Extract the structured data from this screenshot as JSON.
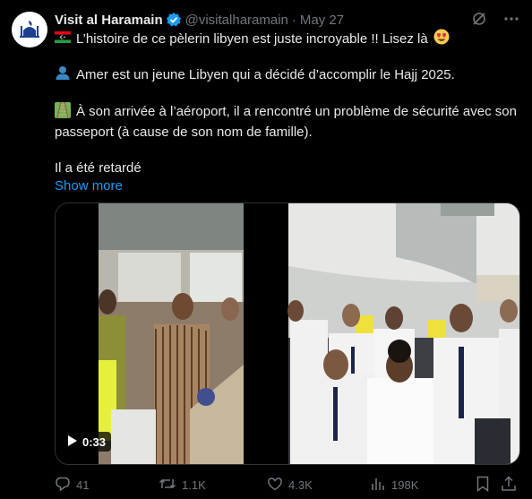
{
  "author": {
    "name": "Visit al Haramain",
    "handle": "@visitalharamain",
    "separator": "·",
    "date": "May 27"
  },
  "post": {
    "line1": "L’histoire de ce pèlerin libyen est juste incroyable !! Lisez là",
    "line2": "Amer est un jeune Libyen qui a décidé d’accomplir le Hajj 2025.",
    "line3": "À son arrivée à l’aéroport, il a rencontré un problème de sécurité avec son passeport (à cause de son nom de famille).",
    "line4": "Il a été retardé",
    "show_more": "Show more"
  },
  "video": {
    "duration": "0:33"
  },
  "actions": {
    "replies": "41",
    "reposts": "1.1K",
    "likes": "4.3K",
    "views": "198K"
  },
  "colors": {
    "background": "#000000",
    "text": "#e7e9ea",
    "muted": "#71767b",
    "link": "#1d9bf0"
  }
}
